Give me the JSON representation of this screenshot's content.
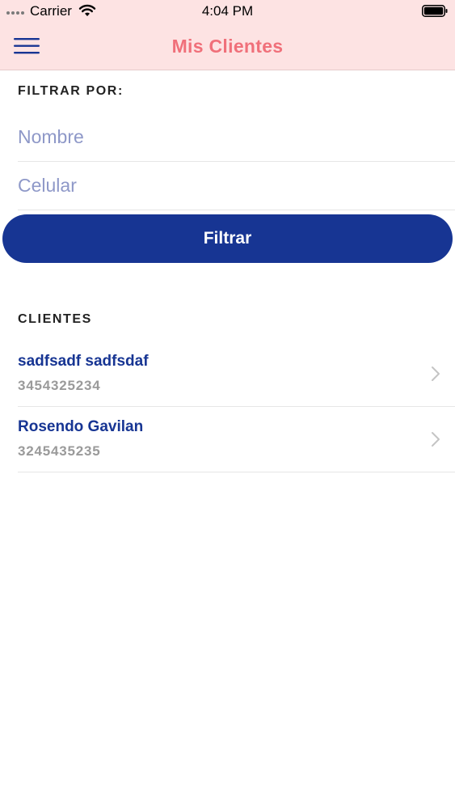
{
  "status_bar": {
    "carrier": "Carrier",
    "time": "4:04 PM",
    "icons": [
      "signal-dots-icon",
      "wifi-icon",
      "battery-icon"
    ]
  },
  "nav": {
    "title": "Mis Clientes",
    "menu_icon": "hamburger-menu-icon"
  },
  "filter": {
    "heading": "FILTRAR POR:",
    "nombre_placeholder": "Nombre",
    "nombre_value": "",
    "celular_placeholder": "Celular",
    "celular_value": "",
    "button_label": "Filtrar"
  },
  "clients": {
    "heading": "CLIENTES",
    "items": [
      {
        "name": "sadfsadf sadfsdaf",
        "phone": "3454325234"
      },
      {
        "name": "Rosendo Gavilan",
        "phone": "3245435235"
      }
    ]
  },
  "colors": {
    "header_bg": "#fde3e3",
    "title_color": "#f0707a",
    "primary": "#173593",
    "placeholder": "#8e98c8",
    "secondary_text": "#9a9a9a"
  }
}
